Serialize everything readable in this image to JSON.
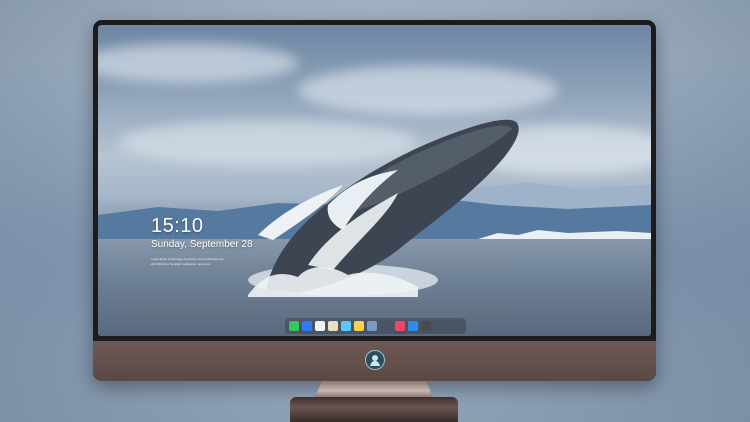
{
  "lock_screen": {
    "time": "15:10",
    "date": "Sunday, September 28",
    "caption_lines": [
      "Learn about technology, browsing, and productivity tips",
      "with Windows Spotlight wallpapers and more"
    ]
  },
  "dock": {
    "apps": [
      {
        "name": "messages-icon",
        "color": "#34c759"
      },
      {
        "name": "finder-icon",
        "color": "#2f7cf6"
      },
      {
        "name": "clock-icon",
        "color": "#f2f2f2"
      },
      {
        "name": "notes-icon",
        "color": "#e9e2c0"
      },
      {
        "name": "clips-icon",
        "color": "#5ac8fa"
      },
      {
        "name": "stickies-icon",
        "color": "#f7d54a"
      },
      {
        "name": "preview-icon",
        "color": "#7a9cc4"
      },
      {
        "name": "music-icon",
        "color": "#f5446a"
      },
      {
        "name": "safari-icon",
        "color": "#2e8cf0"
      },
      {
        "name": "camera-icon",
        "color": "#4a4a52"
      }
    ]
  },
  "colors": {
    "bezel": "#1d1b1d",
    "chin": "#6e5a55",
    "stand": "#c7b8b2"
  }
}
